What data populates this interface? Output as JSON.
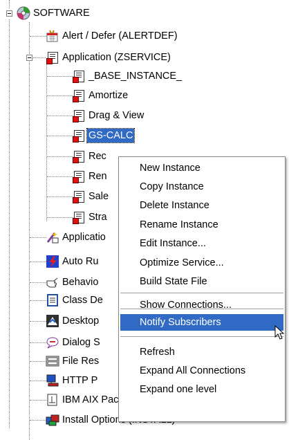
{
  "tree": {
    "root": {
      "label": "SOFTWARE",
      "icon": "cd-disc-icon"
    },
    "items": [
      {
        "label": "Alert / Defer (ALERTDEF)",
        "icon": "alert-defer-icon"
      },
      {
        "label": "Application (ZSERVICE)",
        "icon": "application-class-icon"
      },
      {
        "label": "_BASE_INSTANCE_",
        "icon": "service-instance-icon"
      },
      {
        "label": "Amortize",
        "icon": "service-instance-icon"
      },
      {
        "label": "Drag & View",
        "icon": "service-instance-icon"
      },
      {
        "label": "GS-CALC",
        "icon": "service-instance-icon"
      },
      {
        "label": "Rec",
        "icon": "service-instance-icon"
      },
      {
        "label": "Ren",
        "icon": "service-instance-icon"
      },
      {
        "label": "Sale",
        "icon": "service-instance-icon"
      },
      {
        "label": "Stra",
        "icon": "service-instance-icon"
      },
      {
        "label": "Applicatio",
        "icon": "application-wizard-icon"
      },
      {
        "label": "Auto Ru",
        "icon": "auto-run-icon"
      },
      {
        "label": "Behavio",
        "icon": "hand-icon"
      },
      {
        "label": "Class De",
        "icon": "class-defaults-icon"
      },
      {
        "label": "Desktop",
        "icon": "desktop-icon"
      },
      {
        "label": "Dialog S",
        "icon": "dialog-icon"
      },
      {
        "label": "File Res",
        "icon": "file-resource-icon"
      },
      {
        "label": "HTTP P",
        "icon": "http-proxy-icon"
      },
      {
        "label": "IBM AIX Packages (AIX)",
        "icon": "ibm-aix-icon"
      },
      {
        "label": "Install Options (INSTALL)",
        "icon": "install-options-icon"
      }
    ]
  },
  "context_menu": {
    "group1": [
      "New Instance",
      "Copy Instance",
      "Delete Instance",
      "Rename Instance",
      "Edit Instance...",
      "Optimize Service...",
      "Build State File"
    ],
    "group2": [
      "Show Connections..."
    ],
    "group3": [
      "Notify Subscribers"
    ],
    "group4": [
      "Refresh",
      "Expand All Connections",
      "Expand one level"
    ]
  },
  "colors": {
    "selection": "#316ac5",
    "menu_border": "#868686"
  }
}
